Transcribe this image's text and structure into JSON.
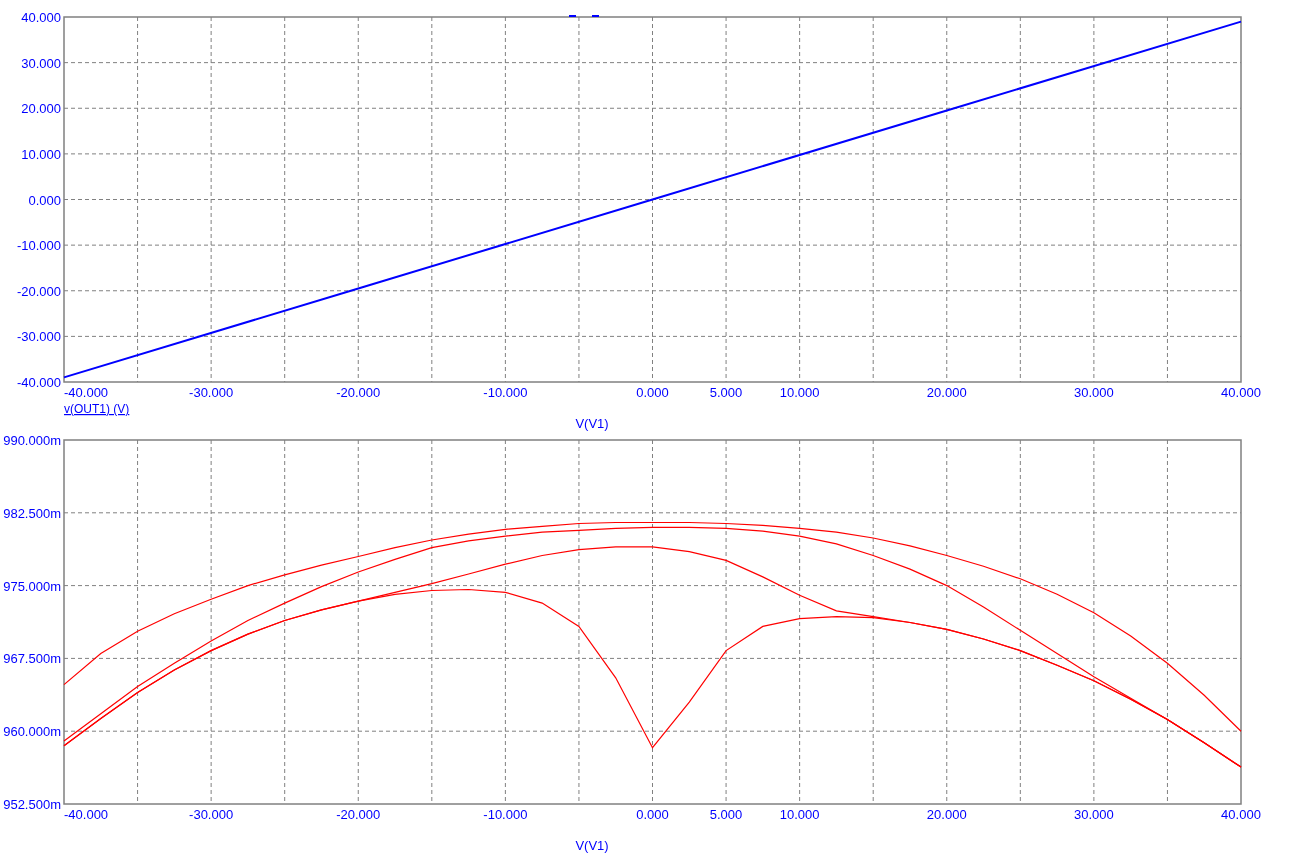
{
  "plots": [
    {
      "chart_data": {
        "type": "line",
        "grid": true,
        "xlabel": "V(V1)",
        "xlim": [
          -40,
          40
        ],
        "ylim": [
          -40,
          40
        ],
        "xticks": [
          {
            "value": -40,
            "label": "-40.000"
          },
          {
            "value": -30,
            "label": "-30.000"
          },
          {
            "value": -20,
            "label": "-20.000"
          },
          {
            "value": -10,
            "label": "-10.000"
          },
          {
            "value": 0,
            "label": "0.000"
          },
          {
            "value": 5,
            "label": "5.000"
          },
          {
            "value": 10,
            "label": "10.000"
          },
          {
            "value": 20,
            "label": "20.000"
          },
          {
            "value": 30,
            "label": "30.000"
          },
          {
            "value": 40,
            "label": "40.000"
          }
        ],
        "yticks": [
          {
            "value": 40,
            "label": "40.000"
          },
          {
            "value": 30,
            "label": "30.000"
          },
          {
            "value": 20,
            "label": "20.000"
          },
          {
            "value": 10,
            "label": "10.000"
          },
          {
            "value": 0,
            "label": "0.000"
          },
          {
            "value": -10,
            "label": "-10.000"
          },
          {
            "value": -20,
            "label": "-20.000"
          },
          {
            "value": -30,
            "label": "-30.000"
          },
          {
            "value": -40,
            "label": "-40.000"
          }
        ],
        "x": [
          -40,
          -20,
          0,
          20,
          40
        ],
        "series": [
          {
            "name": "v(OUT1) (V)",
            "color": "#0000ff",
            "values": [
              -39,
              -19.5,
              0,
              19.5,
              39
            ]
          }
        ]
      }
    },
    {
      "chart_data": {
        "type": "line",
        "grid": true,
        "xlabel": "V(V1)",
        "xlim": [
          -40,
          40
        ],
        "ylim": [
          952.5,
          990
        ],
        "xticks": [
          {
            "value": -40,
            "label": "-40.000"
          },
          {
            "value": -30,
            "label": "-30.000"
          },
          {
            "value": -20,
            "label": "-20.000"
          },
          {
            "value": -10,
            "label": "-10.000"
          },
          {
            "value": 0,
            "label": "0.000"
          },
          {
            "value": 5,
            "label": "5.000"
          },
          {
            "value": 10,
            "label": "10.000"
          },
          {
            "value": 20,
            "label": "20.000"
          },
          {
            "value": 30,
            "label": "30.000"
          },
          {
            "value": 40,
            "label": "40.000"
          }
        ],
        "yticks": [
          {
            "value": 990,
            "label": "990.000m"
          },
          {
            "value": 982.5,
            "label": "982.500m"
          },
          {
            "value": 975,
            "label": "975.000m"
          },
          {
            "value": 967.5,
            "label": "967.500m"
          },
          {
            "value": 960,
            "label": "960.000m"
          },
          {
            "value": 952.5,
            "label": "952.500m"
          }
        ],
        "x": [
          -40,
          -37.5,
          -35,
          -32.5,
          -30,
          -27.5,
          -25,
          -22.5,
          -20,
          -17.5,
          -15,
          -12.5,
          -10,
          -7.5,
          -5,
          -2.5,
          0,
          2.5,
          5,
          7.5,
          10,
          12.5,
          15,
          17.5,
          20,
          22.5,
          25,
          27.5,
          30,
          32.5,
          35,
          37.5,
          40
        ],
        "series": [
          {
            "color": "#ff0000",
            "values": [
              964.8,
              968,
              970.3,
              972.1,
              973.6,
              975,
              976.1,
              977.1,
              978,
              978.9,
              979.7,
              980.3,
              980.8,
              981.1,
              981.4,
              981.5,
              981.5,
              981.5,
              981.4,
              981.2,
              980.9,
              980.5,
              979.9,
              979.1,
              978.1,
              977,
              975.7,
              974.1,
              972.2,
              969.8,
              967,
              963.7,
              960
            ]
          },
          {
            "color": "#ff0000",
            "values": [
              959,
              961.8,
              964.6,
              967,
              969.3,
              971.4,
              973.2,
              974.9,
              976.4,
              977.7,
              978.9,
              979.6,
              980.1,
              980.5,
              980.7,
              980.9,
              981,
              981,
              980.9,
              980.6,
              980.1,
              979.3,
              978.1,
              976.7,
              975,
              972.8,
              970.4,
              968,
              965.6,
              963.4,
              961.2,
              958.8,
              956.3
            ]
          },
          {
            "color": "#ff0000",
            "values": [
              958.5,
              961.3,
              964,
              966.3,
              968.3,
              970,
              971.4,
              972.5,
              973.4,
              974.3,
              975.2,
              976.2,
              977.2,
              978.1,
              978.7,
              979,
              979,
              978.5,
              977.6,
              975.9,
              974,
              972.4,
              971.8,
              971.2,
              970.5,
              969.5,
              968.3,
              966.8,
              965.2,
              963.3,
              961.2,
              958.8,
              956.3
            ]
          },
          {
            "color": "#ff0000",
            "values": [
              958.5,
              961.3,
              964,
              966.3,
              968.3,
              970,
              971.4,
              972.5,
              973.4,
              974.1,
              974.5,
              974.6,
              974.3,
              973.2,
              970.8,
              965.5,
              958.3,
              963,
              968.3,
              970.8,
              971.6,
              971.8,
              971.7,
              971.2,
              970.5,
              969.5,
              968.3,
              966.8,
              965.2,
              963.3,
              961.2,
              958.8,
              956.3
            ]
          }
        ]
      }
    }
  ]
}
